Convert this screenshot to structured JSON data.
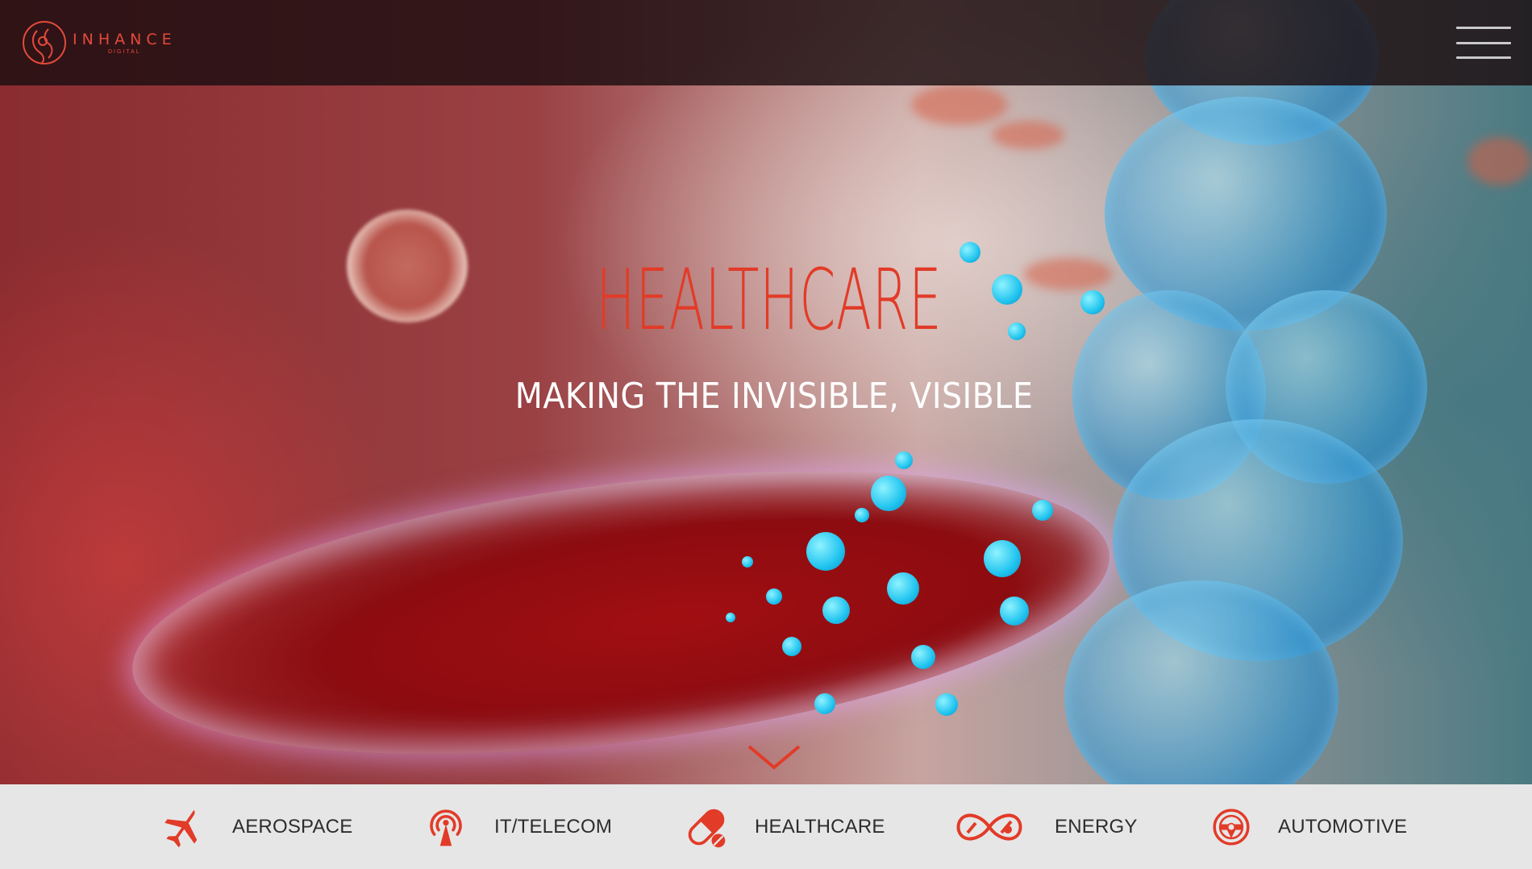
{
  "header": {
    "logo_word": "INHANCE",
    "logo_sub": "DIGITAL",
    "menu_icon": "hamburger-menu-icon"
  },
  "hero": {
    "title": "HEALTHCARE",
    "subtitle": "MAKING THE INVISIBLE, VISIBLE",
    "scroll_icon": "chevron-down-icon"
  },
  "nav": {
    "items": [
      {
        "label": "AEROSPACE",
        "icon": "airplane-icon"
      },
      {
        "label": "IT/TELECOM",
        "icon": "signal-tower-icon"
      },
      {
        "label": "HEALTHCARE",
        "icon": "pill-icon"
      },
      {
        "label": "ENERGY",
        "icon": "infinity-plug-icon"
      },
      {
        "label": "AUTOMOTIVE",
        "icon": "steering-wheel-icon"
      }
    ]
  },
  "colors": {
    "accent": "#e23b28",
    "header_bg": "#1c0e10",
    "nav_bg": "#e6e6e6",
    "nav_text": "#2d2d2d"
  }
}
